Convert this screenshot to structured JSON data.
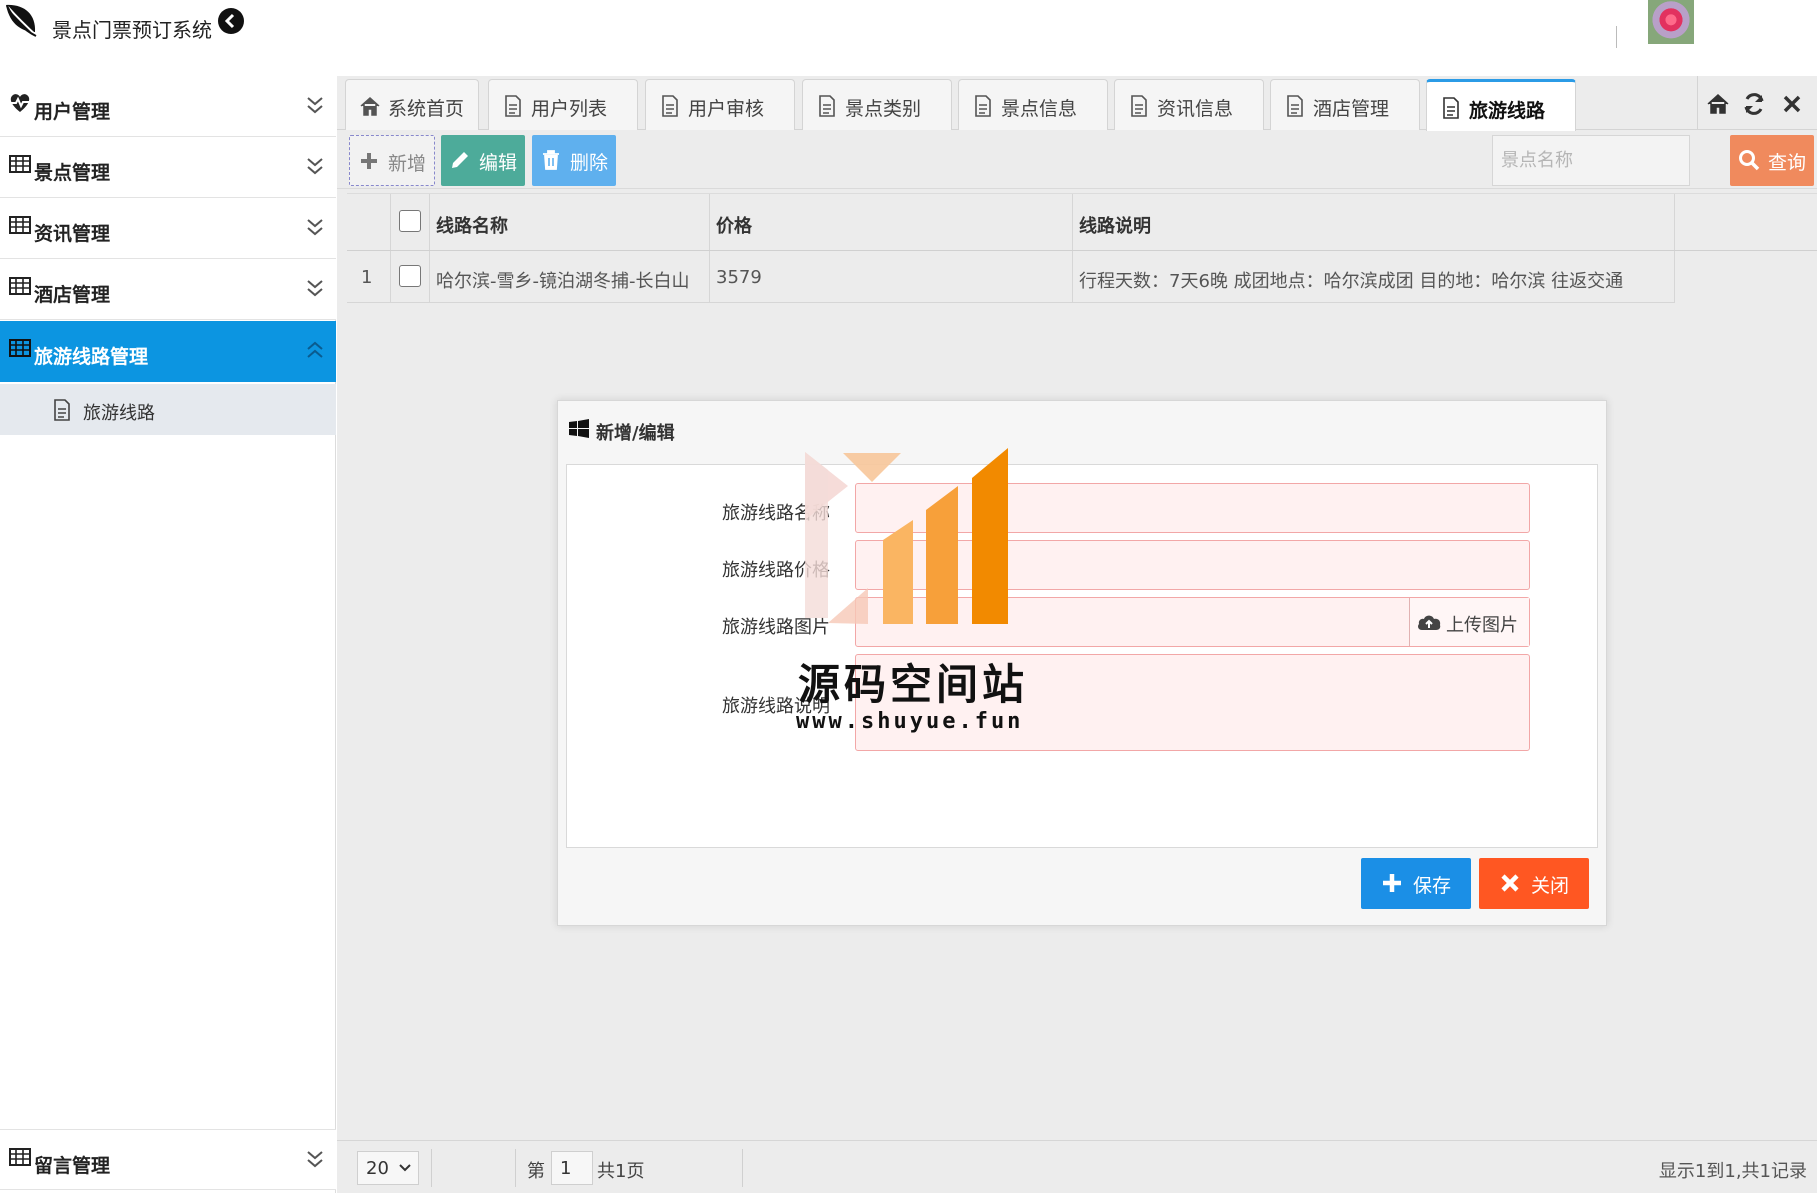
{
  "header": {
    "app_title": "景点门票预订系统"
  },
  "sidebar": {
    "groups": [
      {
        "label": "用户管理",
        "icon": "heart-pulse-icon"
      },
      {
        "label": "景点管理",
        "icon": "table-icon"
      },
      {
        "label": "资讯管理",
        "icon": "table-icon"
      },
      {
        "label": "酒店管理",
        "icon": "table-icon"
      },
      {
        "label": "旅游线路管理",
        "icon": "table-icon",
        "active": true
      },
      {
        "label": "留言管理",
        "icon": "table-icon"
      }
    ],
    "sub_items": [
      {
        "label": "旅游线路",
        "icon": "document-icon"
      }
    ]
  },
  "tabs": [
    {
      "label": "系统首页",
      "icon": "home-icon"
    },
    {
      "label": "用户列表",
      "icon": "document-icon"
    },
    {
      "label": "用户审核",
      "icon": "document-icon"
    },
    {
      "label": "景点类别",
      "icon": "document-icon"
    },
    {
      "label": "景点信息",
      "icon": "document-icon"
    },
    {
      "label": "资讯信息",
      "icon": "document-icon"
    },
    {
      "label": "酒店管理",
      "icon": "document-icon"
    },
    {
      "label": "旅游线路",
      "icon": "document-icon",
      "active": true
    }
  ],
  "toolbar": {
    "add_label": "新增",
    "edit_label": "编辑",
    "delete_label": "删除",
    "search_placeholder": "景点名称",
    "query_label": "查询"
  },
  "table": {
    "columns": [
      "线路名称",
      "价格",
      "线路说明"
    ],
    "rows": [
      {
        "index": "1",
        "name": "哈尔滨-雪乡-镜泊湖冬捕-长白山",
        "price": "3579",
        "desc": "行程天数：7天6晚 成团地点：哈尔滨成团 目的地：哈尔滨 往返交通"
      }
    ]
  },
  "dialog": {
    "title": "新增/编辑",
    "fields": [
      {
        "label": "旅游线路名称",
        "value": ""
      },
      {
        "label": "旅游线路价格",
        "value": ""
      },
      {
        "label": "旅游线路图片",
        "value": ""
      },
      {
        "label": "旅游线路说明",
        "value": ""
      }
    ],
    "upload_label": "上传图片",
    "save_label": "保存",
    "close_label": "关闭"
  },
  "watermark": {
    "title": "源码空间站",
    "url": "www.shuyue.fun"
  },
  "pager": {
    "page_size": "20",
    "page_prefix": "第",
    "page_number": "1",
    "page_total": "共1页",
    "summary": "显示1到1,共1记录"
  },
  "colors": {
    "sidebar_active": "#0c95e1",
    "edit_button": "#4dab9a",
    "delete_button": "#5fb0ee",
    "query_button": "#f08a5d",
    "save_button": "#1b8fe6",
    "close_button": "#ff5722"
  }
}
